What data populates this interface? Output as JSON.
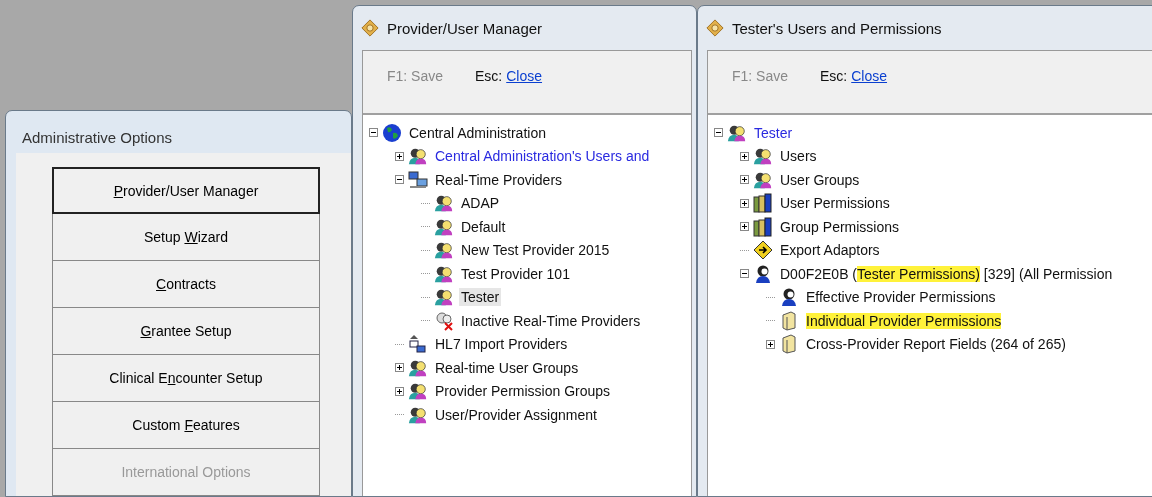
{
  "admin_window": {
    "title": "Administrative Options",
    "buttons": [
      {
        "key": "P",
        "after": "rovider/User Manager",
        "default": true,
        "disabled": false
      },
      {
        "before": "Setup ",
        "key": "W",
        "after": "izard",
        "default": false,
        "disabled": false
      },
      {
        "key": "C",
        "after": "ontracts",
        "default": false,
        "disabled": false
      },
      {
        "key": "G",
        "after": "rantee Setup",
        "default": false,
        "disabled": false
      },
      {
        "before": "Clinical E",
        "key": "n",
        "after": "counter Setup",
        "default": false,
        "disabled": false
      },
      {
        "before": "Custom ",
        "key": "F",
        "after": "eatures",
        "default": false,
        "disabled": false
      },
      {
        "before": "International Options",
        "default": false,
        "disabled": true
      }
    ]
  },
  "windows": [
    {
      "title": "Provider/User Manager",
      "toolbar": {
        "save": {
          "label": "F1: Save",
          "disabled": true
        },
        "close_key": "Esc:",
        "close_link": "Close"
      },
      "tree": [
        {
          "label": "Central Administration",
          "kind": "globe",
          "expanded": true,
          "link": false,
          "selected": false,
          "highlighted": false,
          "children": [
            {
              "label": "Central Administration's Users and",
              "kind": "people",
              "expanded": false,
              "link": true,
              "selected": false,
              "highlighted": false
            },
            {
              "label": "Real-Time Providers",
              "kind": "network",
              "expanded": true,
              "link": false,
              "selected": false,
              "highlighted": false,
              "children": [
                {
                  "label": "ADAP",
                  "kind": "people",
                  "link": false,
                  "selected": false,
                  "highlighted": false
                },
                {
                  "label": "Default",
                  "kind": "people",
                  "link": false,
                  "selected": false,
                  "highlighted": false
                },
                {
                  "label": "New Test Provider 2015",
                  "kind": "people",
                  "link": false,
                  "selected": false,
                  "highlighted": false
                },
                {
                  "label": "Test Provider 101",
                  "kind": "people",
                  "link": false,
                  "selected": false,
                  "highlighted": false
                },
                {
                  "label": "Tester",
                  "kind": "people",
                  "link": false,
                  "selected": true,
                  "highlighted": false
                },
                {
                  "label": "Inactive Real-Time Providers",
                  "kind": "inactive",
                  "link": false,
                  "selected": false,
                  "highlighted": false
                }
              ]
            },
            {
              "label": "HL7 Import Providers",
              "kind": "import",
              "link": false,
              "selected": false,
              "highlighted": false
            },
            {
              "label": "Real-time User Groups",
              "kind": "people",
              "expanded": false,
              "link": false,
              "selected": false,
              "highlighted": false
            },
            {
              "label": "Provider Permission Groups",
              "kind": "people",
              "expanded": false,
              "link": false,
              "selected": false,
              "highlighted": false
            },
            {
              "label": "User/Provider Assignment",
              "kind": "people",
              "link": false,
              "selected": false,
              "highlighted": false
            }
          ]
        }
      ]
    },
    {
      "title": "Tester's Users and Permissions",
      "toolbar": {
        "save": {
          "label": "F1: Save",
          "disabled": true
        },
        "close_key": "Esc:",
        "close_link": "Close"
      },
      "tree": [
        {
          "label": "Tester",
          "kind": "people",
          "expanded": true,
          "link": true,
          "selected": false,
          "highlighted": false,
          "children": [
            {
              "label": "Users",
              "kind": "people",
              "expanded": false,
              "link": false,
              "selected": false,
              "highlighted": false
            },
            {
              "label": "User Groups",
              "kind": "people",
              "expanded": false,
              "link": false,
              "selected": false,
              "highlighted": false
            },
            {
              "label": "User Permissions",
              "kind": "books",
              "expanded": false,
              "link": false,
              "selected": false,
              "highlighted": false
            },
            {
              "label": "Group Permissions",
              "kind": "books",
              "expanded": false,
              "link": false,
              "selected": false,
              "highlighted": false
            },
            {
              "label": "Export Adaptors",
              "kind": "sign",
              "link": false,
              "selected": false,
              "highlighted": false
            },
            {
              "segments": [
                {
                  "text": "D00F2E0B (",
                  "highlighted": false
                },
                {
                  "text": "Tester Permissions)",
                  "highlighted": true
                },
                {
                  "text": " [329] (All Permission",
                  "highlighted": false
                }
              ],
              "kind": "person",
              "expanded": true,
              "link": false,
              "selected": false,
              "children": [
                {
                  "label": "Effective Provider Permissions",
                  "kind": "person",
                  "link": false,
                  "selected": false,
                  "highlighted": false
                },
                {
                  "label": "Individual Provider Permissions",
                  "kind": "folder",
                  "link": false,
                  "selected": false,
                  "highlighted": true
                },
                {
                  "label": "Cross-Provider Report Fields (264 of 265)",
                  "kind": "folder",
                  "expanded": false,
                  "link": false,
                  "selected": false,
                  "highlighted": false
                }
              ]
            }
          ]
        }
      ]
    }
  ]
}
